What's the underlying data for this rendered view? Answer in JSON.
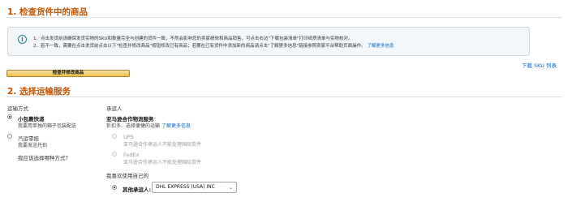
{
  "section1": {
    "title": "1. 检查货件中的商品"
  },
  "info": {
    "icon": "info-icon",
    "line1": "1．点击发货前请确保发货实物的SKU和数量完全与创建的货件一致，不然会影响您的卖家绩效和商品销售，可点击右边\"下载包装清单\"打印纸质清单与实物核对。",
    "line2_text": "2．若不一致，需要在点击发货前点击以下\"检查并修改商品\"按钮修改已有商品；若要在已有货件中添加新的商品请点击\"了解更多信息\"链接参照卖家平台帮助页面操作。",
    "line2_link": "了解更多信息"
  },
  "download_sku": "下载 SKU 列表",
  "check_button": "检查并修改商品",
  "section2": {
    "title": "2. 选择运输服务"
  },
  "shipping": {
    "header": "运输方式",
    "options": [
      {
        "title": "小包裹快递",
        "desc": "我要用单独的箱子包装配送",
        "selected": true
      },
      {
        "title": "汽运零担",
        "desc": "我要发送托拍",
        "selected": false
      }
    ],
    "help_link": "我应该选择哪种方式？"
  },
  "carrier": {
    "header": "承运人",
    "partner_title": "亚马逊合作物流服务",
    "partner_desc": "折扣多、选择便捷的运输",
    "partner_link": "了解更多信息",
    "options": [
      {
        "title": "UPS",
        "desc": "亚马逊合作承运人不能处理国际货件",
        "disabled": true
      },
      {
        "title": "FedEx",
        "desc": "亚马逊合作承运人不能处理国际货件",
        "disabled": true
      }
    ],
    "own_label": "我喜欢使用自己的",
    "other_label": "其他承运人:",
    "selected_value": "DHL EXPRESS (USA) INC"
  }
}
